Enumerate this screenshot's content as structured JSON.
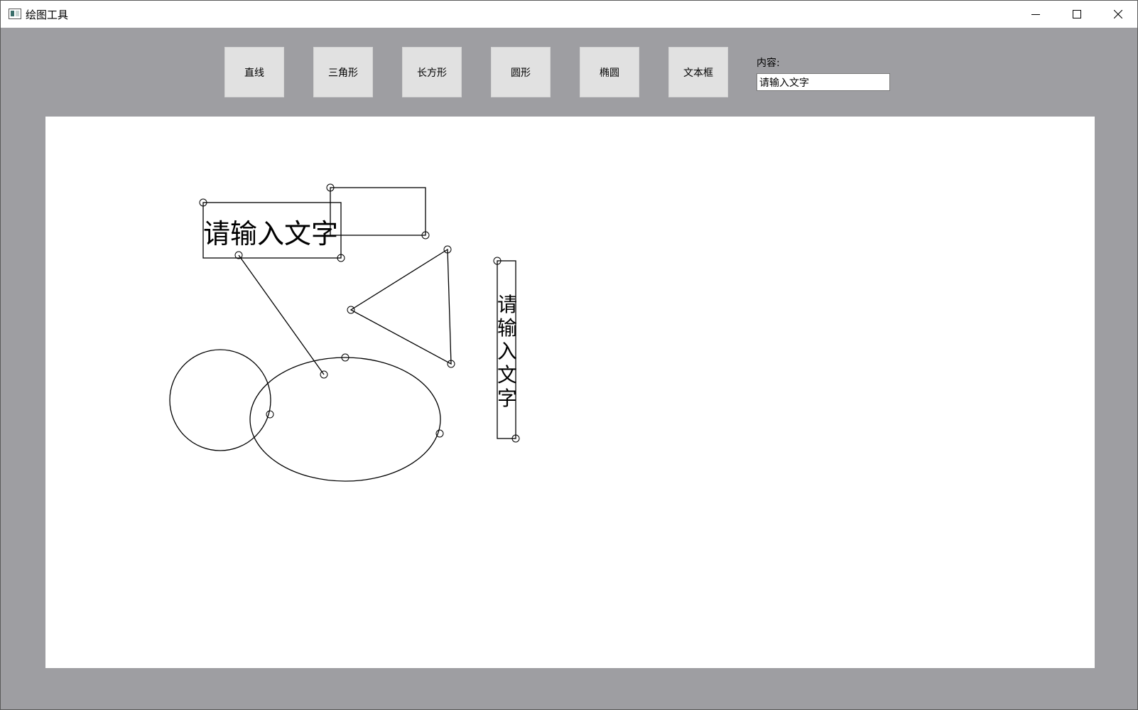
{
  "window": {
    "title": "绘图工具",
    "controls": {
      "minimize": "minimize-icon",
      "maximize": "maximize-icon",
      "close": "close-icon"
    }
  },
  "toolbar": {
    "buttons": [
      {
        "label": "直线"
      },
      {
        "label": "三角形"
      },
      {
        "label": "长方形"
      },
      {
        "label": "圆形"
      },
      {
        "label": "椭圆"
      },
      {
        "label": "文本框"
      }
    ],
    "content_label": "内容:",
    "content_value": "请输入文字"
  },
  "canvas": {
    "shapes": [
      {
        "type": "textbox",
        "orientation": "horizontal",
        "text": "请输入文字"
      },
      {
        "type": "rectangle"
      },
      {
        "type": "line"
      },
      {
        "type": "triangle"
      },
      {
        "type": "circle"
      },
      {
        "type": "ellipse"
      },
      {
        "type": "textbox",
        "orientation": "vertical",
        "text": "请输入文字",
        "chars": [
          "请",
          "输",
          "入",
          "文",
          "字"
        ]
      }
    ]
  },
  "colors": {
    "window_bg": "#9e9ea2",
    "titlebar_bg": "#ffffff",
    "button_bg": "#e1e1e1",
    "canvas_bg": "#ffffff",
    "stroke": "#000000"
  }
}
